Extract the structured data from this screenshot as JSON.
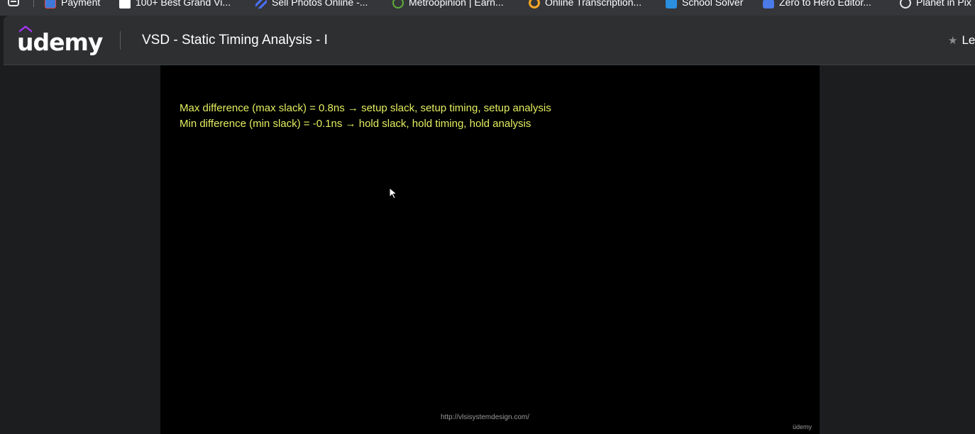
{
  "bookmarks": {
    "items": [
      {
        "label": "Payment",
        "icon": "payment-icon"
      },
      {
        "label": "100+ Best Grand Vi...",
        "icon": "plus-square-icon"
      },
      {
        "label": "Sell Photos Online -...",
        "icon": "stripes-icon"
      },
      {
        "label": "Metroopinion | Earn...",
        "icon": "metro-icon"
      },
      {
        "label": "Online Transcription...",
        "icon": "g-icon"
      },
      {
        "label": "School Solver",
        "icon": "ss-icon"
      },
      {
        "label": "Zero to Hero Editor...",
        "icon": "person-icon"
      },
      {
        "label": "Planet in Pix",
        "icon": "globe-icon"
      }
    ]
  },
  "header": {
    "logo": "udemy",
    "course_title": "VSD - Static Timing Analysis - I",
    "rating_label": "Le"
  },
  "video": {
    "lines": [
      "Max difference (max slack) = 0.8ns → setup slack, setup timing, setup analysis",
      "Min difference (min slack) = -0.1ns → hold slack, hold timing, hold analysis"
    ],
    "url": "http://vlsisystemdesign.com/",
    "watermark": "üdemy"
  },
  "colors": {
    "header_bg": "#2d2f31",
    "page_bg": "#1c1d1f",
    "slide_text": "#e4ee5f",
    "brand_purple": "#a435f0"
  }
}
